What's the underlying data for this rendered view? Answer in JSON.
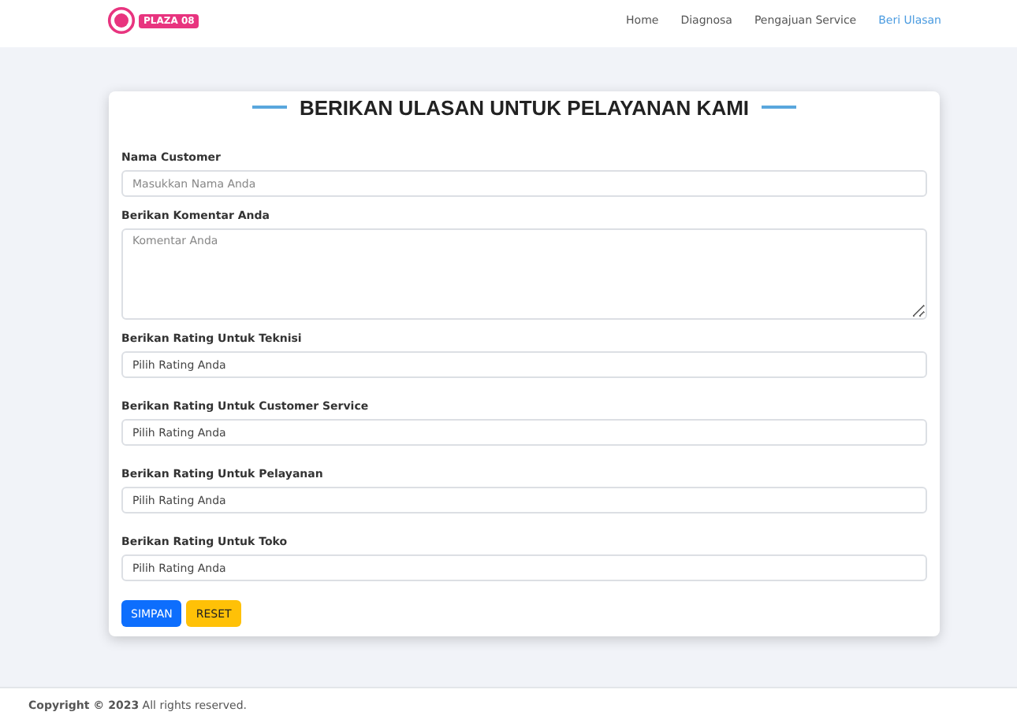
{
  "logo": {
    "text": "PLAZA 08"
  },
  "nav": [
    {
      "label": "Home",
      "selected": false
    },
    {
      "label": "Diagnosa",
      "selected": false
    },
    {
      "label": "Pengajuan Service",
      "selected": false
    },
    {
      "label": "Beri Ulasan",
      "selected": true
    }
  ],
  "form": {
    "title": "BERIKAN ULASAN UNTUK PELAYANAN KAMI",
    "fields": [
      {
        "kind": "text",
        "label": "Nama Customer",
        "placeholder": "Masukkan Nama Anda"
      },
      {
        "kind": "textarea",
        "label": "Berikan Komentar Anda",
        "placeholder": "Komentar Anda"
      },
      {
        "kind": "select",
        "label": "Berikan Rating Untuk Teknisi",
        "value": "Pilih Rating Anda"
      },
      {
        "kind": "select",
        "label": "Berikan Rating Untuk Customer Service",
        "value": "Pilih Rating Anda"
      },
      {
        "kind": "select",
        "label": "Berikan Rating Untuk Pelayanan",
        "value": "Pilih Rating Anda"
      },
      {
        "kind": "select",
        "label": "Berikan Rating Untuk Toko",
        "value": "Pilih Rating Anda"
      }
    ],
    "buttons": [
      {
        "kind": "primary",
        "label": "SIMPAN"
      },
      {
        "kind": "warning",
        "label": "RESET"
      }
    ]
  },
  "footer": {
    "text": "**Copyright © 2023** All rights reserved."
  }
}
